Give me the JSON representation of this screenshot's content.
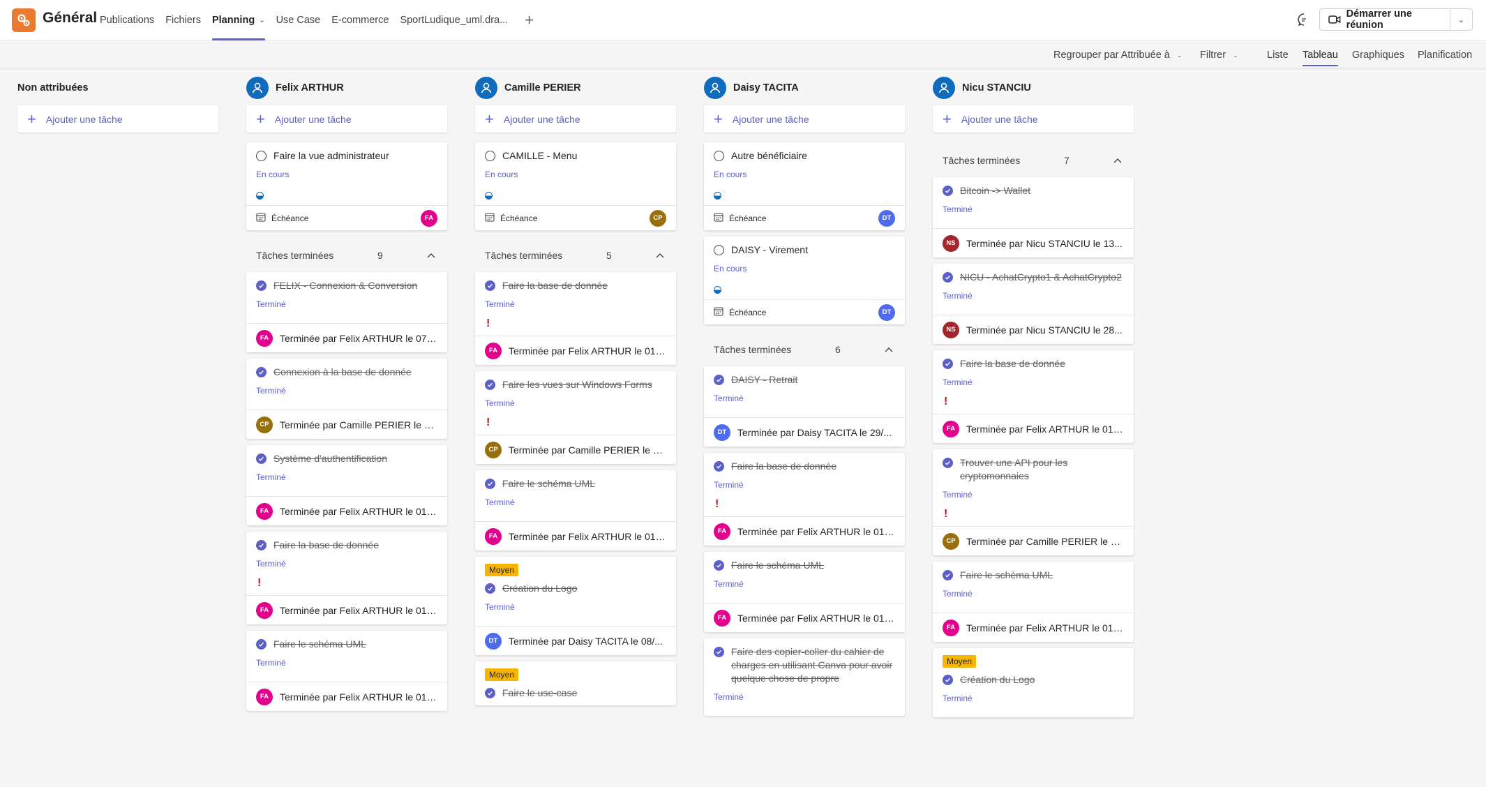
{
  "header": {
    "channel_title": "Général",
    "tabs": [
      {
        "label": "Publications"
      },
      {
        "label": "Fichiers"
      },
      {
        "label": "Planning",
        "active": true
      },
      {
        "label": "Use Case"
      },
      {
        "label": "E-commerce"
      },
      {
        "label": "SportLudique_uml.dra..."
      }
    ],
    "meet_label": "Démarrer une réunion"
  },
  "toolbar": {
    "group_by": "Regrouper par Attribuée à",
    "filter": "Filtrer",
    "views": [
      "Liste",
      "Tableau",
      "Graphiques",
      "Planification"
    ],
    "active_view": "Tableau"
  },
  "colors": {
    "accent": "#5b5fc7",
    "FA": "#e3008c",
    "CP": "#986f0b",
    "DT": "#4f6bed",
    "NS": "#a4262c",
    "moyen": "#f7b500",
    "urgent": "#c50f1f"
  },
  "board": {
    "add_task_label": "Ajouter une tâche",
    "due_label": "Échéance",
    "completed_label": "Tâches terminées",
    "columns": [
      {
        "name": "Non attribuées"
      },
      {
        "name": "Felix ARTHUR",
        "active": [
          {
            "title": "Faire la vue administrateur",
            "status": "En cours",
            "avatar": "FA"
          }
        ],
        "done_count": "9",
        "done": [
          {
            "title": "FELIX - Connexion & Conversion",
            "status": "Terminé",
            "by": "Terminée par Felix ARTHUR le 07/...",
            "avatar": "FA"
          },
          {
            "title": "Connexion à la base de donnée",
            "status": "Terminé",
            "by": "Terminée par Camille PERIER le 0...",
            "avatar": "CP"
          },
          {
            "title": "Système d'authentification",
            "status": "Terminé",
            "by": "Terminée par Felix ARTHUR le 01/...",
            "avatar": "FA"
          },
          {
            "title": "Faire la base de donnée",
            "status": "Terminé",
            "urgent": "!",
            "by": "Terminée par Felix ARTHUR le 01/...",
            "avatar": "FA"
          },
          {
            "title": "Faire le schéma UML",
            "status": "Terminé",
            "by": "Terminée par Felix ARTHUR le 01/...",
            "avatar": "FA"
          }
        ]
      },
      {
        "name": "Camille PERIER",
        "active": [
          {
            "title": "CAMILLE - Menu",
            "status": "En cours",
            "avatar": "CP"
          }
        ],
        "done_count": "5",
        "done": [
          {
            "title": "Faire la base de donnée",
            "status": "Terminé",
            "urgent": "!",
            "by": "Terminée par Felix ARTHUR le 01/...",
            "avatar": "FA"
          },
          {
            "title": "Faire les vues sur Windows Forms",
            "status": "Terminé",
            "urgent": "!",
            "by": "Terminée par Camille PERIER le 0...",
            "avatar": "CP"
          },
          {
            "title": "Faire le schéma UML",
            "status": "Terminé",
            "by": "Terminée par Felix ARTHUR le 01/...",
            "avatar": "FA"
          },
          {
            "label": "Moyen",
            "title": "Création du Logo",
            "status": "Terminé",
            "by": "Terminée par Daisy TACITA le 08/...",
            "avatar": "DT"
          },
          {
            "label": "Moyen",
            "title": "Faire le use-case"
          }
        ]
      },
      {
        "name": "Daisy TACITA",
        "active": [
          {
            "title": "Autre bénéficiaire",
            "status": "En cours",
            "avatar": "DT"
          },
          {
            "title": "DAISY - Virement",
            "status": "En cours",
            "avatar": "DT"
          }
        ],
        "done_count": "6",
        "done": [
          {
            "title": "DAISY - Retrait",
            "status": "Terminé",
            "by": "Terminée par Daisy TACITA le 29/...",
            "avatar": "DT"
          },
          {
            "title": "Faire la base de donnée",
            "status": "Terminé",
            "urgent": "!",
            "by": "Terminée par Felix ARTHUR le 01/...",
            "avatar": "FA"
          },
          {
            "title": "Faire le schéma UML",
            "status": "Terminé",
            "by": "Terminée par Felix ARTHUR le 01/...",
            "avatar": "FA"
          },
          {
            "title": "Faire des copier-coller du cahier de charges en utilisant Canva pour avoir quelque chose de propre",
            "status": "Terminé"
          }
        ]
      },
      {
        "name": "Nicu STANCIU",
        "done_count": "7",
        "done": [
          {
            "title": "Bitcoin -> Wallet",
            "status": "Terminé",
            "by": "Terminée par Nicu STANCIU le 13...",
            "avatar": "NS"
          },
          {
            "title": "NICU - AchatCrypto1 & AchatCrypto2",
            "status": "Terminé",
            "by": "Terminée par Nicu STANCIU le 28...",
            "avatar": "NS"
          },
          {
            "title": "Faire la base de donnée",
            "status": "Terminé",
            "urgent": "!",
            "by": "Terminée par Felix ARTHUR le 01/...",
            "avatar": "FA"
          },
          {
            "title": "Trouver une API pour les cryptomonnaies",
            "status": "Terminé",
            "urgent": "!",
            "by": "Terminée par Camille PERIER le 0...",
            "avatar": "CP"
          },
          {
            "title": "Faire le schéma UML",
            "status": "Terminé",
            "by": "Terminée par Felix ARTHUR le 01/...",
            "avatar": "FA"
          },
          {
            "label": "Moyen",
            "title": "Création du Logo",
            "status": "Terminé"
          }
        ]
      }
    ]
  }
}
